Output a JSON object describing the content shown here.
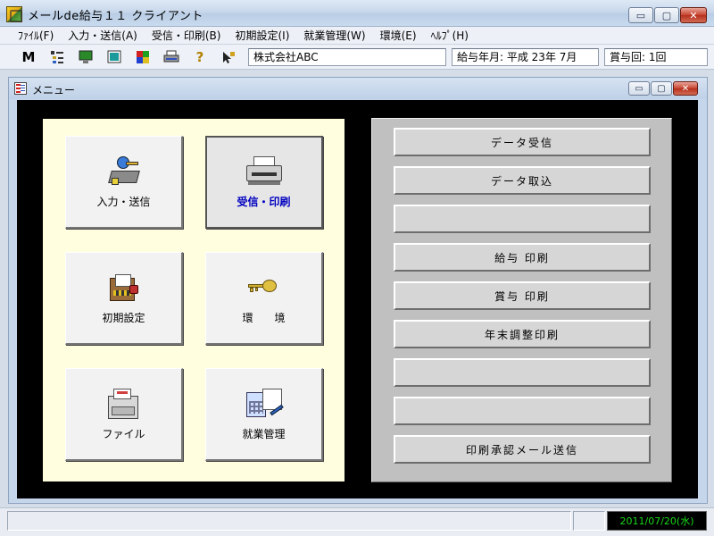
{
  "window": {
    "title": "メールde給与１１ クライアント",
    "min_glyph": "▭",
    "max_glyph": "▢",
    "close_glyph": "✕"
  },
  "menu": [
    "ﾌｧｲﾙ(F)",
    "入力・送信(A)",
    "受信・印刷(B)",
    "初期設定(I)",
    "就業管理(W)",
    "環境(E)",
    "ﾍﾙﾌﾟ(H)"
  ],
  "toolbar": {
    "company": "株式会社ABC",
    "pay_period": "給与年月: 平成 23年  7月",
    "bonus_count": "賞与回: 1回",
    "m_glyph": "M",
    "help_glyph": "?"
  },
  "child_window": {
    "title": "メニュー"
  },
  "menu_buttons": [
    {
      "label": "入力・送信",
      "icon": "send-icon"
    },
    {
      "label": "受信・印刷",
      "icon": "printer-icon",
      "selected": true
    },
    {
      "label": "初期設定",
      "icon": "setup-icon"
    },
    {
      "label": "環　　境",
      "icon": "key-icon"
    },
    {
      "label": "ファイル",
      "icon": "file-cabinet-icon"
    },
    {
      "label": "就業管理",
      "icon": "calculator-icon"
    }
  ],
  "action_buttons": [
    "データ受信",
    "データ取込",
    "",
    "給与 印刷",
    "賞与 印刷",
    "年末調整印刷",
    "",
    "",
    "印刷承認メール送信"
  ],
  "status": {
    "date": "2011/07/20(水)",
    "date_color": "#18d818"
  }
}
